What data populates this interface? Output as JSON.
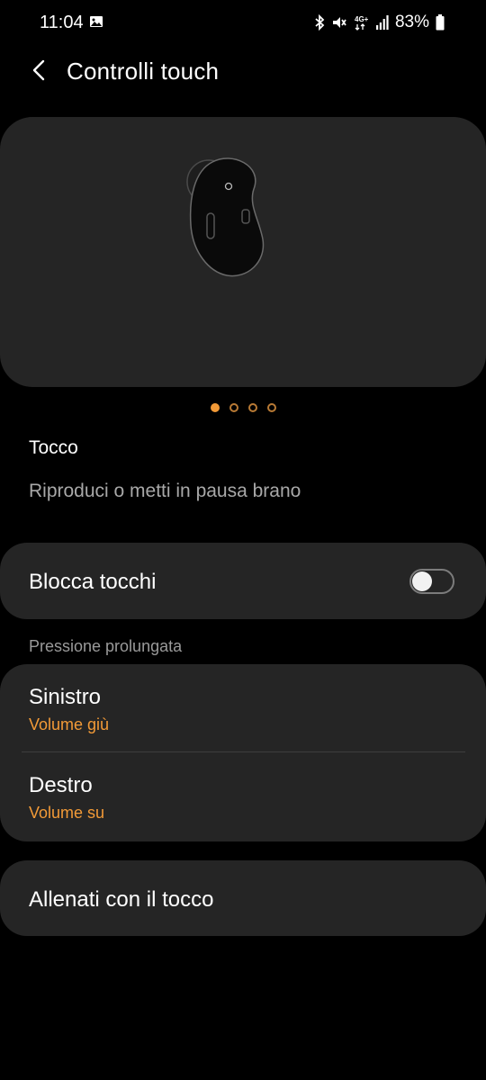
{
  "status_bar": {
    "time": "11:04",
    "network": "4G+",
    "battery": "83%"
  },
  "header": {
    "title": "Controlli touch",
    "back_icon": "chevron-left-icon"
  },
  "illustration": {
    "icon": "earbud-illustration",
    "pages": 4,
    "active_page": 1
  },
  "tap": {
    "title": "Tocco",
    "description": "Riproduci o metti in pausa brano"
  },
  "lock_touch": {
    "label": "Blocca tocchi",
    "enabled": false
  },
  "long_press": {
    "header": "Pressione prolungata",
    "items": [
      {
        "title": "Sinistro",
        "value": "Volume giù"
      },
      {
        "title": "Destro",
        "value": "Volume su"
      }
    ]
  },
  "practice": {
    "label": "Allenati con il tocco"
  },
  "colors": {
    "accent": "#f29a37",
    "card_bg": "#252525",
    "background": "#000000"
  }
}
